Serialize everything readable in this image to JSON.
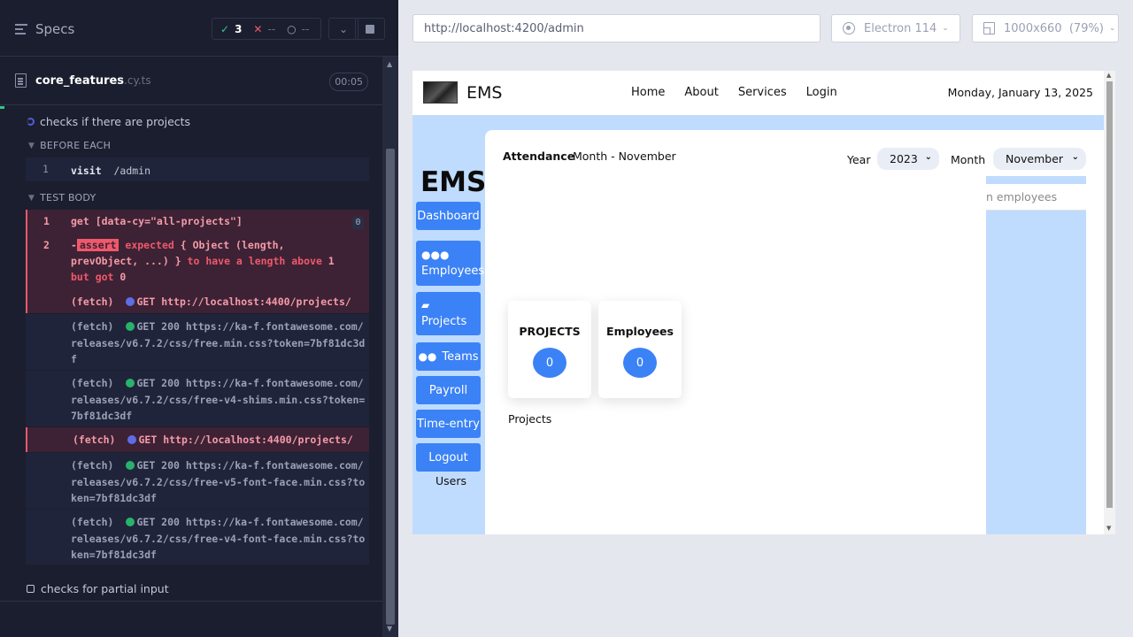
{
  "runner": {
    "specs_label": "Specs",
    "stats": {
      "passed": "3",
      "failed": "--",
      "pending": "--"
    },
    "spec_file": {
      "name": "core_features",
      "ext": ".cy.ts",
      "duration": "00:05"
    },
    "test1_title": "checks if there are projects",
    "before_each_label": "BEFORE EACH",
    "test_body_label": "TEST BODY",
    "before_cmd": {
      "num": "1",
      "name": "visit",
      "arg": "/admin"
    },
    "cmd1": {
      "num": "1",
      "text": "get  [data-cy=\"all-projects\"]",
      "badge": "0"
    },
    "cmd2": {
      "num": "2",
      "prefix": "-",
      "tag": "assert",
      "line1": " expected ",
      "line1b": "{ Object (length,",
      "line2": "prevObject, ...) }",
      "line2b": " to have a length above ",
      "line2c": "1",
      "line3": "but got ",
      "line3b": "0"
    },
    "fetch_rows": [
      {
        "label": "(fetch)",
        "method": "GET",
        "text": "http://localhost:4400/projects/",
        "status": "pending"
      },
      {
        "label": "(fetch)",
        "method": "GET 200",
        "text": "https://ka-f.fontawesome.com/releases/v6.7.2/css/free.min.css?token=7bf81dc3df",
        "status": "ok"
      },
      {
        "label": "(fetch)",
        "method": "GET 200",
        "text": "https://ka-f.fontawesome.com/releases/v6.7.2/css/free-v4-shims.min.css?token=7bf81dc3df",
        "status": "ok"
      },
      {
        "label": "(fetch)",
        "method": "GET",
        "text": "http://localhost:4400/projects/",
        "status": "pending"
      },
      {
        "label": "(fetch)",
        "method": "GET 200",
        "text": "https://ka-f.fontawesome.com/releases/v6.7.2/css/free-v5-font-face.min.css?token=7bf81dc3df",
        "status": "ok"
      },
      {
        "label": "(fetch)",
        "method": "GET 200",
        "text": "https://ka-f.fontawesome.com/releases/v6.7.2/css/free-v4-font-face.min.css?token=7bf81dc3df",
        "status": "ok"
      }
    ],
    "test2_title": "checks for partial input"
  },
  "aut": {
    "url": "http://localhost:4200/admin",
    "browser": "Electron 114",
    "viewport": "1000x660",
    "zoom": "(79%)"
  },
  "app": {
    "brand": "EMS",
    "nav": [
      "Home",
      "About",
      "Services",
      "Login"
    ],
    "date": "Monday, January 13, 2025",
    "sidebar_title": "EMS",
    "sidebar": {
      "dashboard": "Dashboard",
      "employees": "Employees",
      "projects": "Projects",
      "teams": "Teams",
      "payroll": "Payroll",
      "time_entry": "Time-entry",
      "logout": "Logout",
      "users": "Users"
    },
    "attendance": {
      "title": "Attendance",
      "month_text": "Month - November"
    },
    "year_label": "Year",
    "year_value": "2023",
    "month_label": "Month",
    "month_value": "November",
    "employees_partial": "n employees",
    "cards": {
      "projects_label": "PROJECTS",
      "projects_value": "0",
      "employees_label": "Employees",
      "employees_value": "0"
    },
    "projects_text": "Projects"
  },
  "colors": {
    "accent": "#3b82f6",
    "fail": "#f0586b",
    "pass": "#35c48b",
    "bg_panel": "#1b1e2e"
  }
}
